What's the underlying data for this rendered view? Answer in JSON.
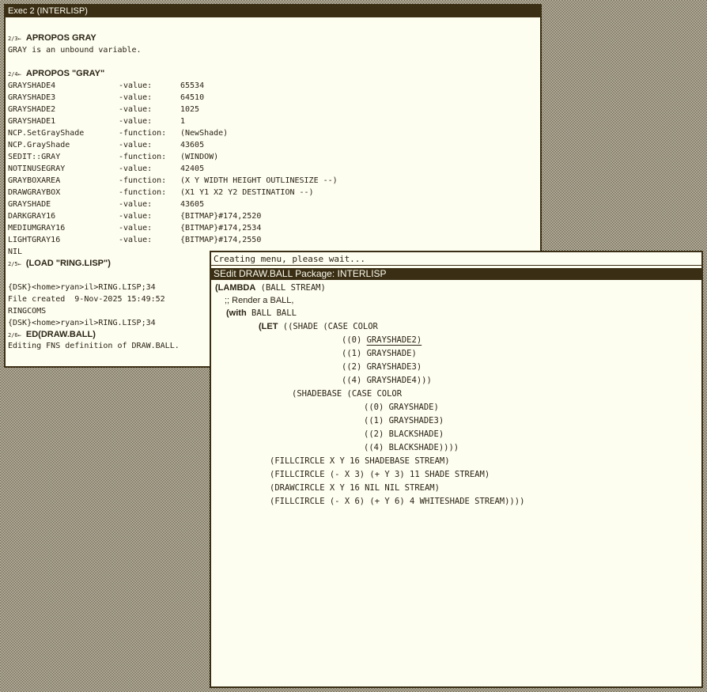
{
  "exec_window": {
    "title": "Exec 2 (INTERLISP)",
    "cmd1": {
      "prompt": "2/3←",
      "text": "APROPOS GRAY"
    },
    "cmd1_output": "GRAY is an unbound variable.",
    "cmd2": {
      "prompt": "2/4←",
      "text": "APROPOS \"GRAY\""
    },
    "apropos_rows": [
      {
        "name": "GRAYSHADE4",
        "kind": "-value:",
        "val": "65534"
      },
      {
        "name": "GRAYSHADE3",
        "kind": "-value:",
        "val": "64510"
      },
      {
        "name": "GRAYSHADE2",
        "kind": "-value:",
        "val": "1025"
      },
      {
        "name": "GRAYSHADE1",
        "kind": "-value:",
        "val": "1"
      },
      {
        "name": "NCP.SetGrayShade",
        "kind": "-function:",
        "val": "(NewShade)"
      },
      {
        "name": "NCP.GrayShade",
        "kind": "-value:",
        "val": "43605"
      },
      {
        "name": "SEDIT::GRAY",
        "kind": "-function:",
        "val": "(WINDOW)"
      },
      {
        "name": "NOTINUSEGRAY",
        "kind": "-value:",
        "val": "42405"
      },
      {
        "name": "GRAYBOXAREA",
        "kind": "-function:",
        "val": "(X Y WIDTH HEIGHT OUTLINESIZE --)"
      },
      {
        "name": "DRAWGRAYBOX",
        "kind": "-function:",
        "val": "(X1 Y1 X2 Y2 DESTINATION --)"
      },
      {
        "name": "GRAYSHADE",
        "kind": "-value:",
        "val": "43605"
      },
      {
        "name": "DARKGRAY16",
        "kind": "-value:",
        "val": "{BITMAP}#174,2520"
      },
      {
        "name": "MEDIUMGRAY16",
        "kind": "-value:",
        "val": "{BITMAP}#174,2534"
      },
      {
        "name": "LIGHTGRAY16",
        "kind": "-value:",
        "val": "{BITMAP}#174,2550"
      }
    ],
    "nil": "NIL",
    "cmd3": {
      "prompt": "2/5←",
      "text": "(LOAD \"RING.LISP\")"
    },
    "load_output": [
      "{DSK}<home>ryan>il>RING.LISP;34",
      "File created  9-Nov-2025 15:49:52",
      "RINGCOMS",
      "{DSK}<home>ryan>il>RING.LISP;34"
    ],
    "cmd4": {
      "prompt": "2/6←",
      "text": "ED(DRAW.BALL)"
    },
    "cmd4_output": "Editing FNS definition of DRAW.BALL."
  },
  "sedit_window": {
    "prompt_text": "Creating menu, please wait...",
    "title": "SEdit DRAW.BALL  Package: INTERLISP",
    "code": {
      "l1_kw": "(LAMBDA",
      "l1_rest": " (BALL STREAM)",
      "l2": ";; Render a BALL,",
      "l3_kw": "(with",
      "l3_rest": " BALL BALL",
      "l4_kw": "(LET",
      "l4_rest": " ((SHADE (CASE COLOR",
      "l5_a": "((0) ",
      "l5_b": "GRAYSHADE2)",
      "l6": "((1) GRAYSHADE)",
      "l7": "((2) GRAYSHADE3)",
      "l8": "((4) GRAYSHADE4)))",
      "l9": "(SHADEBASE (CASE COLOR",
      "l10": "((0) GRAYSHADE)",
      "l11": "((1) GRAYSHADE3)",
      "l12": "((2) BLACKSHADE)",
      "l13": "((4) BLACKSHADE))))",
      "l14": "(FILLCIRCLE X Y 16 SHADEBASE STREAM)",
      "l15": "(FILLCIRCLE (- X 3) (+ Y 3) 11 SHADE STREAM)",
      "l16": "(DRAWCIRCLE X Y 16 NIL NIL STREAM)",
      "l17": "(FILLCIRCLE (- X 6) (+ Y 6) 4 WHITESHADE STREAM))))"
    }
  }
}
